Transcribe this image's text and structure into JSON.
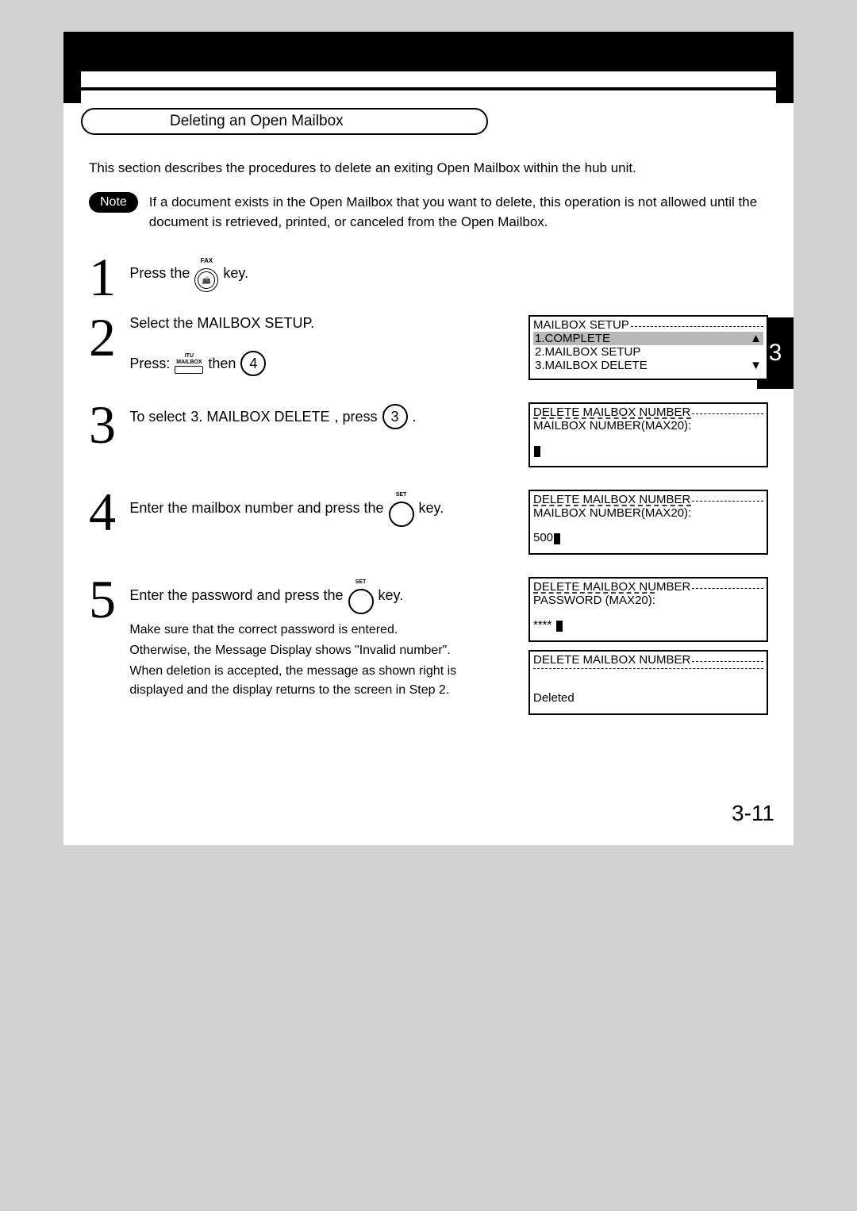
{
  "section_title": "Deleting an Open Mailbox",
  "intro": "This section describes the procedures to delete an exiting Open Mailbox within the hub unit.",
  "note_label": "Note",
  "note_text": "If a document exists in the Open Mailbox that you want to delete, this operation is not allowed until the document is retrieved, printed, or canceled from the Open Mailbox.",
  "chapter_tab": "3",
  "page_number": "3-11",
  "fax_label": "FAX",
  "itu_label": "ITU",
  "mailbox_label": "MAILBOX",
  "set_label": "SET",
  "steps": {
    "s1": {
      "text_a": "Press the",
      "text_b": "key."
    },
    "s2": {
      "text_a": "Select the MAILBOX SETUP.",
      "text_b": "Press:",
      "text_c": "then",
      "key": "4"
    },
    "s3": {
      "text_a": "To select",
      "text_b": "3. MAILBOX DELETE",
      "text_c": ", press",
      "key": "3",
      "text_d": "."
    },
    "s4": {
      "text_a": "Enter the mailbox number and press the",
      "text_b": "key."
    },
    "s5": {
      "text_a": "Enter the password and press the",
      "text_b": "key.",
      "note1": "Make sure that the correct password is entered.",
      "note2": "Otherwise, the Message Display shows \"Invalid number\".",
      "note3": "When deletion is accepted, the message as shown right is displayed and the display returns to the screen in Step 2."
    }
  },
  "lcd": {
    "a": {
      "title": "MAILBOX SETUP",
      "l1": "1.COMPLETE",
      "l2": "2.MAILBOX SETUP",
      "l3": "3.MAILBOX DELETE",
      "up": "▲",
      "down": "▼"
    },
    "b": {
      "title": "DELETE MAILBOX NUMBER",
      "l1": "MAILBOX NUMBER(MAX20):"
    },
    "c": {
      "title": "DELETE MAILBOX NUMBER",
      "l1": "MAILBOX NUMBER(MAX20):",
      "val": "500"
    },
    "d": {
      "title": "DELETE MAILBOX NUMBER",
      "l1": "PASSWORD (MAX20):",
      "val": "****"
    },
    "e": {
      "title": "DELETE MAILBOX NUMBER",
      "val": "Deleted"
    }
  }
}
